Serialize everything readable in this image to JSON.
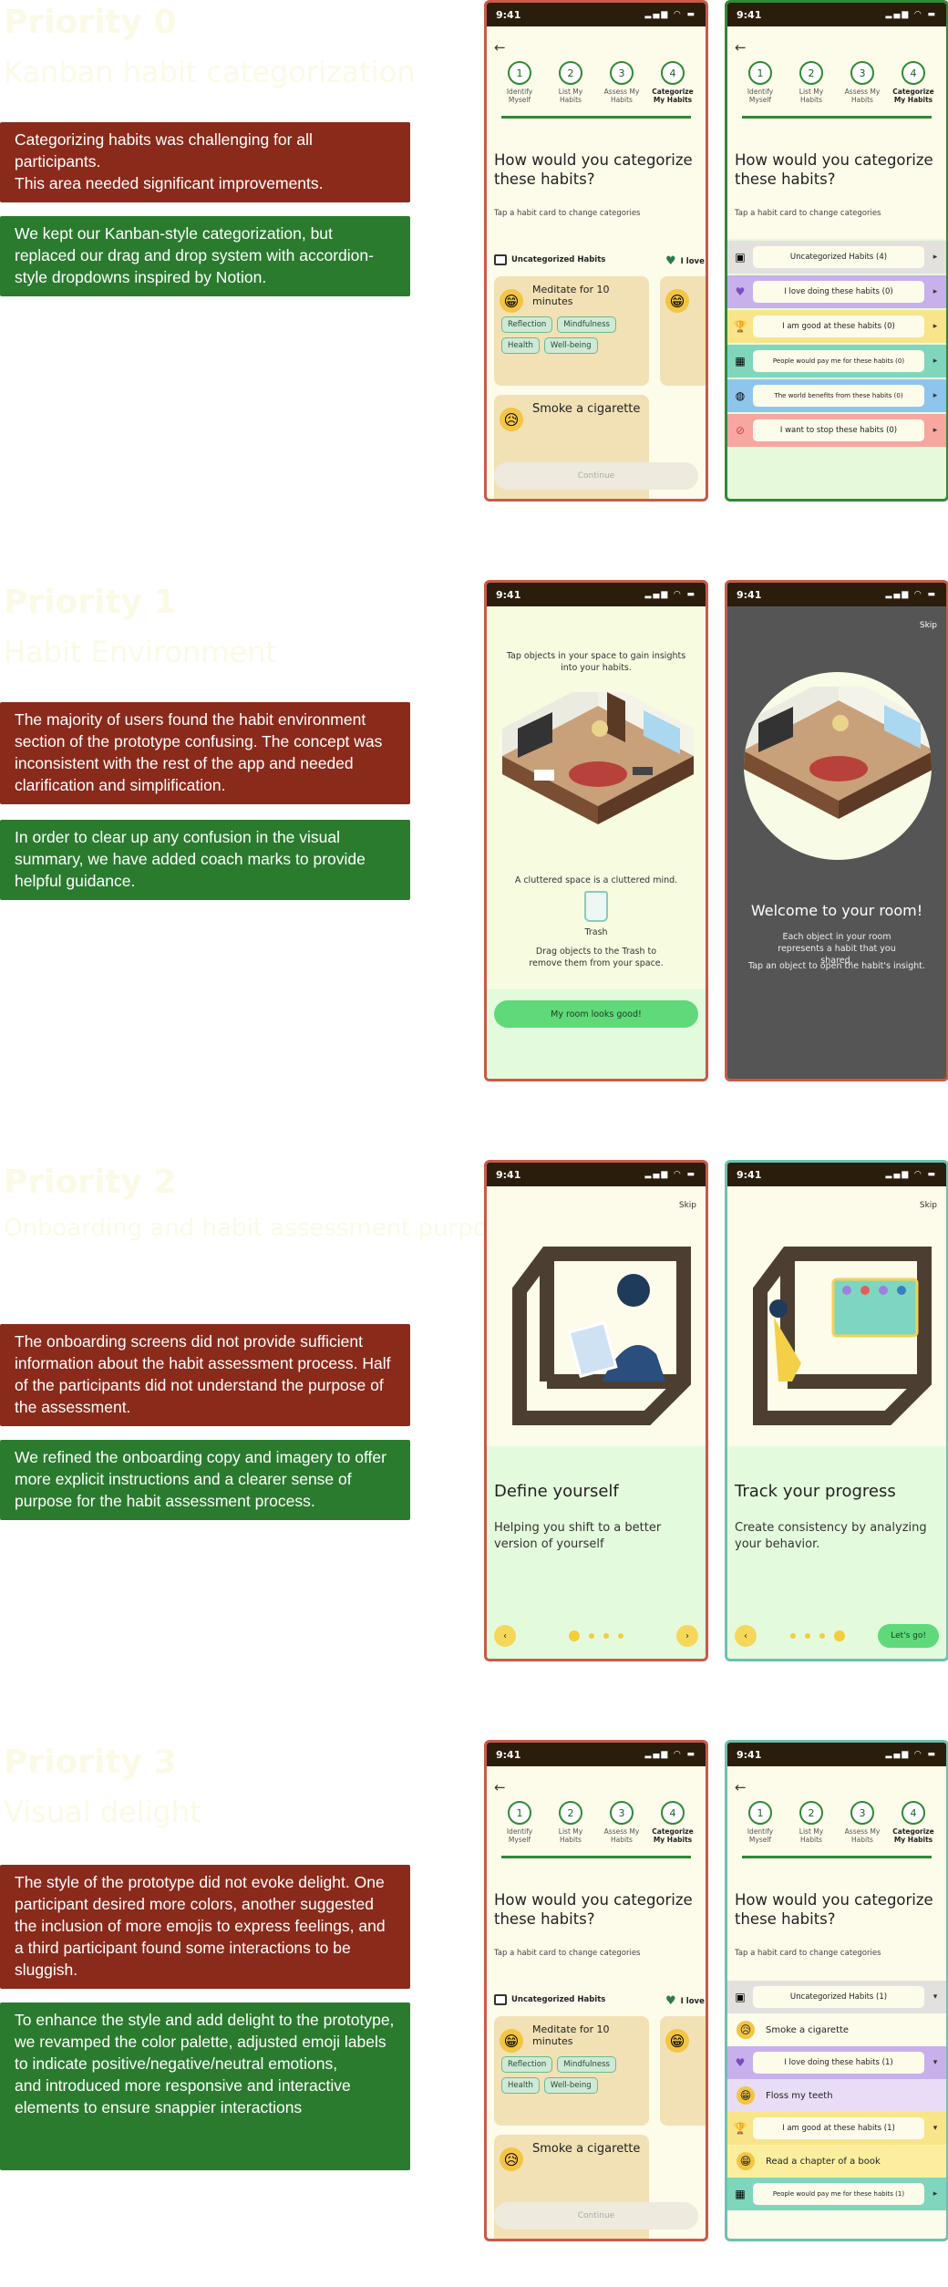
{
  "sections": [
    {
      "title": "Priority 0",
      "subtitle": "Kanban habit categorization",
      "problem": "Categorizing habits was challenging for all participants.\nThis area needed significant improvements.",
      "solution": "We kept our Kanban-style categorization, but replaced our drag and drop system with accordion-style dropdowns inspired by Notion."
    },
    {
      "title": "Priority 1",
      "subtitle": "Habit Environment",
      "problem": "The majority of users found the habit environment section of the prototype confusing. The concept was inconsistent with the rest of the app and needed clarification and simplification.",
      "solution": "In order to clear up any confusion in the visual summary, we have added coach marks to provide helpful guidance."
    },
    {
      "title": "Priority 2",
      "subtitle": "Onboarding and habit assessment purpose",
      "problem": "The onboarding screens did not provide sufficient information about the habit assessment process. Half of the participants did not understand the purpose of the assessment.",
      "solution": "We refined the onboarding copy and imagery to offer more explicit instructions and a clearer sense of purpose for the habit assessment process."
    },
    {
      "title": "Priority 3",
      "subtitle": "Visual delight",
      "problem": "The style of the prototype did not evoke delight. One participant desired more colors, another suggested the inclusion of more emojis to express feelings, and a third participant found some interactions to be sluggish.",
      "solution": "To enhance the style and add delight to the prototype,\nwe revamped the color palette, adjusted emoji labels to indicate positive/negative/neutral emotions,\nand introduced more responsive and interactive elements to ensure snappier interactions"
    }
  ],
  "phone": {
    "time": "9:41",
    "back": "←",
    "steps": [
      {
        "n": "1",
        "label": "Identify Myself"
      },
      {
        "n": "2",
        "label": "List My Habits"
      },
      {
        "n": "3",
        "label": "Assess My Habits"
      },
      {
        "n": "4",
        "label": "Categorize My Habits"
      }
    ],
    "question": "How would you categorize these habits?",
    "hint": "Tap a habit card to change categories",
    "col_uncat": "Uncategorized Habits",
    "col_love": "I love",
    "card1": "Meditate for 10 minutes",
    "card1_tags": [
      "Reflection",
      "Mindfulness",
      "Health",
      "Well-being"
    ],
    "card2": "Smoke a cigarette",
    "continue": "Continue",
    "cats_v0": [
      "Uncategorized Habits (4)",
      "I love doing these habits (0)",
      "I am good at these habits (0)",
      "People would pay me for these habits (0)",
      "The world benefits from these habits (0)",
      "I want to stop these habits (0)"
    ],
    "cats_v3": [
      "Uncategorized Habits (1)",
      "I love doing these habits (1)",
      "I am good at these habits (1)",
      "People would pay me for these habits (1)"
    ],
    "sub_v3": [
      "Smoke a cigarette",
      "Floss my teeth",
      "Read a chapter of a book"
    ],
    "room_prompt": "Tap objects in your space to gain insights into your habits.",
    "cluttered": "A cluttered space is a cluttered mind.",
    "trash": "Trash",
    "drag": "Drag objects to the Trash to remove them from your space.",
    "room_btn": "My room looks good!",
    "skip": "Skip",
    "welcome": "Welcome to your room!",
    "welcome_1": "Each object in your room represents a habit that you shared.",
    "welcome_2": "Tap an object to open the habit's insight.",
    "ob1_title": "Define yourself",
    "ob1_sub": "Helping you shift to a better version of yourself",
    "ob2_title": "Track your progress",
    "ob2_sub": "Create consistency by analyzing your behavior.",
    "letsgo": "Let's go!"
  }
}
